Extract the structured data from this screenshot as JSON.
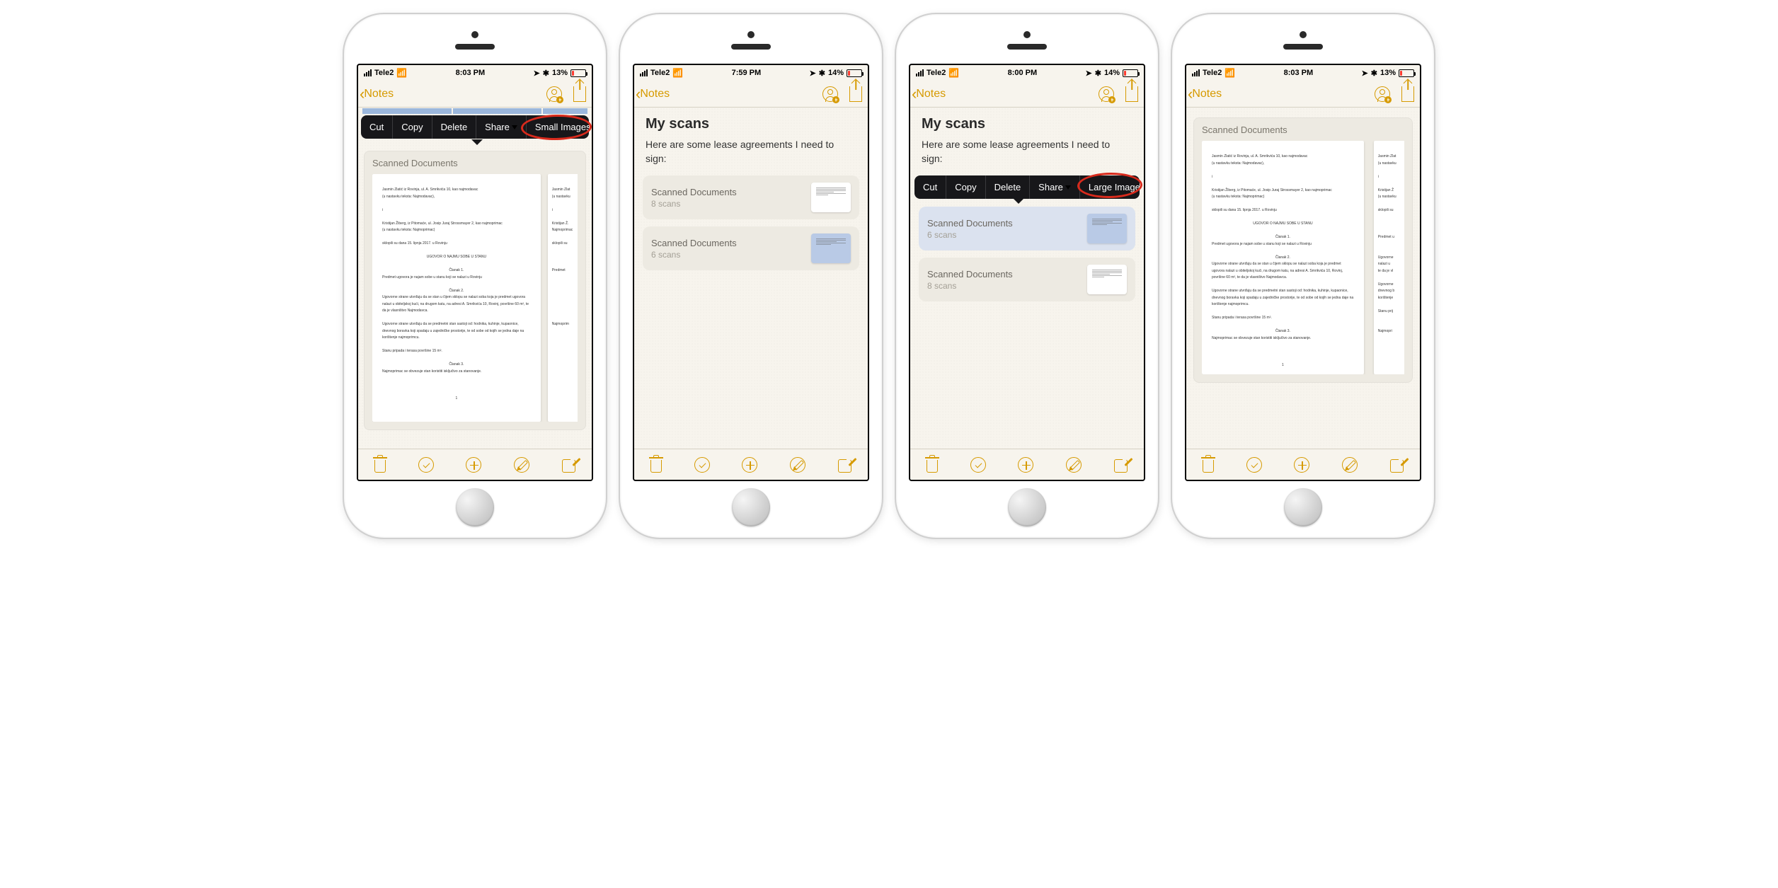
{
  "common": {
    "carrier": "Tele2",
    "back_label": "Notes",
    "attach_title": "Scanned Documents",
    "menu": {
      "cut": "Cut",
      "copy": "Copy",
      "delete": "Delete",
      "share": "Share"
    }
  },
  "note": {
    "title": "My scans",
    "subtitle": "Here are some lease agreements I need to sign:"
  },
  "phones": [
    {
      "time": "8:03 PM",
      "battery": "13%",
      "last_action": "Small Images"
    },
    {
      "time": "7:59 PM",
      "battery": "14%",
      "cards": [
        {
          "title": "Scanned Documents",
          "sub": "8 scans",
          "blue": false
        },
        {
          "title": "Scanned Documents",
          "sub": "6 scans",
          "blue": true
        }
      ]
    },
    {
      "time": "8:00 PM",
      "battery": "14%",
      "last_action": "Large Images",
      "cards": [
        {
          "title": "Scanned Documents",
          "sub": "6 scans",
          "blue": true
        },
        {
          "title": "Scanned Documents",
          "sub": "8 scans",
          "blue": false
        }
      ]
    },
    {
      "time": "8:03 PM",
      "battery": "13%"
    }
  ],
  "doc_lines": {
    "l1": "Jasmin Zlatić iz Rovinja, ul. A. Smrikvića 10, kao najmodavac",
    "l2": "(u nastavku teksta: Najmodavac),",
    "l3": "i",
    "l4": "Kristijan Žiberg, iz Pitomaće, ul. Josip Juraj Strossmayer 2, kao najmoprimac",
    "l5": "(u nastavku teksta: Najmoprimac)",
    "l6": "sklopili su dana 15. lipnja 2017. u Rovinju",
    "h1": "UGOVOR O NAJMU SOBE U STANU",
    "h2": "Članak 1.",
    "l7": "Predmet ugovora je najam sobe u stanu koji se nalazi u Rovinju",
    "h3": "Članak 2.",
    "l8": "Ugovorne strane utvrđuju da se stan u čijem sklopu se nalazi soba koja je predmet ugovora nalazi u obiteljskoj kući, na drugom katu, na adresi A. Smrikvića 10, Rovinj, površine 60 m², te da je vlasništvo Najmodavca.",
    "l9": "Ugovorne strane utvrđuju da se predmetni stan sastoji od: hodnika, kuhinje, kupaonice, dnevnog boravka koji spadaju u zajedničke prostorije, te od sobe od kojih se jedna daje na korištenje najmoprimcu.",
    "l10": "Stanu pripada i terasa površine 15 m².",
    "h4": "Članak 3.",
    "l11": "Najmoprimac se obvezuje stan koristiti isključivo za stanovanje.",
    "p": "1"
  }
}
